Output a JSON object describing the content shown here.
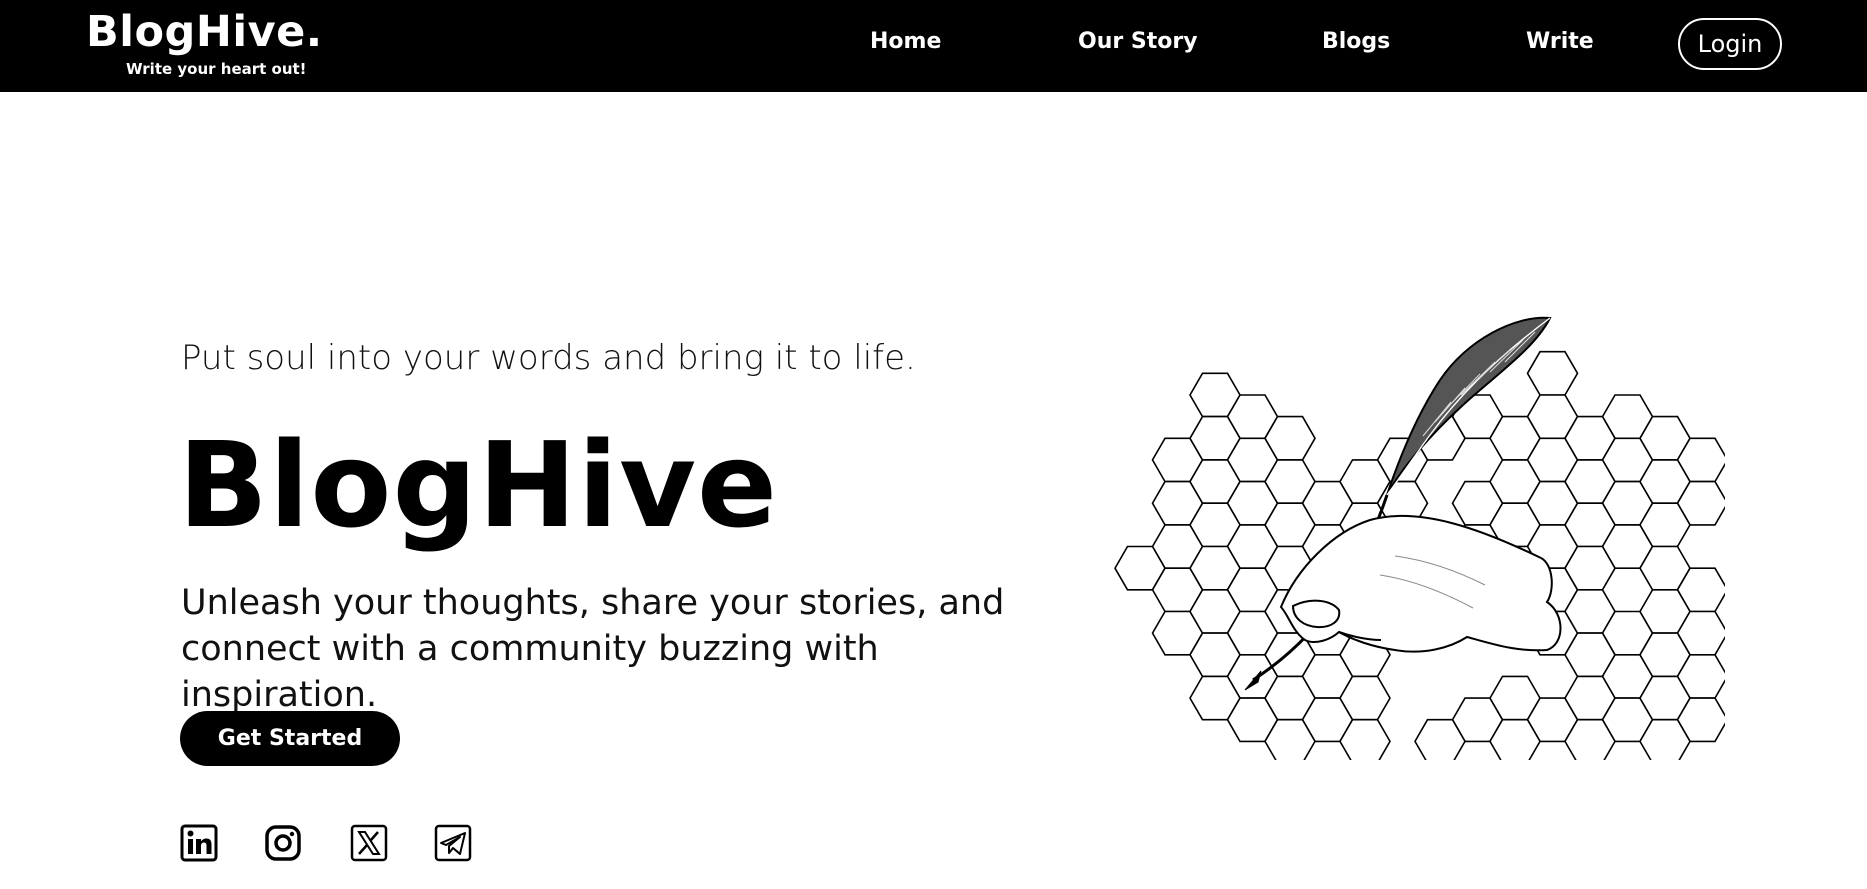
{
  "brand": {
    "title": "BlogHive.",
    "tagline": "Write your heart out!"
  },
  "nav": {
    "links": [
      "Home",
      "Our Story",
      "Blogs",
      "Write"
    ],
    "login": "Login"
  },
  "hero": {
    "eyebrow": "Put soul into your words and bring it to life.",
    "title": "BlogHive",
    "description": "Unleash your thoughts, share your stories, and connect with a community buzzing with inspiration.",
    "cta": "Get Started"
  },
  "social": [
    "linkedin-icon",
    "instagram-icon",
    "x-icon",
    "telegram-icon"
  ],
  "illustration": {
    "subject": "quill-hand-honeycomb-illustration"
  },
  "colors": {
    "nav_bg": "#000000",
    "page_bg": "#ffffff",
    "cta_bg": "#000000"
  }
}
